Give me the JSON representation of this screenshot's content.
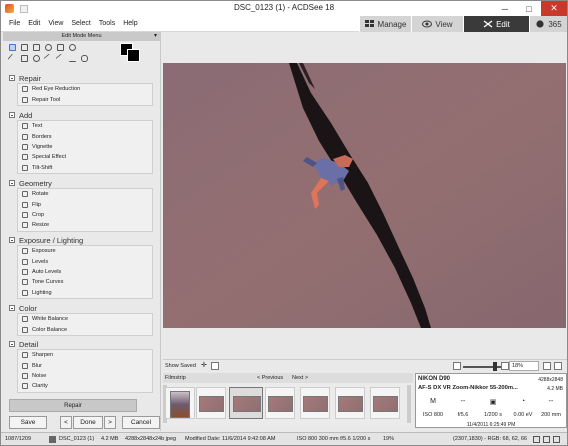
{
  "window": {
    "title": "DSC_0123 (1) - ACDSee 18",
    "min": "─",
    "max": "□",
    "close": "✕"
  },
  "menu": [
    "File",
    "Edit",
    "View",
    "Select",
    "Tools",
    "Help"
  ],
  "modes": {
    "manage": "Manage",
    "view": "View",
    "edit": "Edit",
    "s365": "365"
  },
  "left": {
    "panel_title": "Edit Mode Menu",
    "groups": [
      {
        "title": "Repair",
        "items": [
          "Red Eye Reduction",
          "Repair Tool"
        ]
      },
      {
        "title": "Add",
        "items": [
          "Text",
          "Borders",
          "Vignette",
          "Special Effect",
          "Tilt-Shift"
        ]
      },
      {
        "title": "Geometry",
        "items": [
          "Rotate",
          "Flip",
          "Crop",
          "Resize"
        ]
      },
      {
        "title": "Exposure / Lighting",
        "items": [
          "Exposure",
          "Levels",
          "Auto Levels",
          "Tone Curves",
          "Lighting"
        ]
      },
      {
        "title": "Color",
        "items": [
          "White Balance",
          "Color Balance"
        ]
      },
      {
        "title": "Detail",
        "items": [
          "Sharpen",
          "Blur",
          "Noise",
          "Clarity"
        ]
      }
    ],
    "repair_button": "Repair",
    "save": "Save",
    "done": "Done",
    "cancel": "Cancel",
    "prev": "<",
    "next": ">"
  },
  "viewbar": {
    "show_saved": "Show Saved",
    "zoom": "18%"
  },
  "filmstrip": {
    "label": "Filmstrip",
    "previous": "< Previous",
    "next": "Next >"
  },
  "info": {
    "camera": "NIKON D90",
    "lens": "AF-S DX VR Zoom-Nikkor 55-200m...",
    "dims": "4288x2848",
    "size": "4.2 MB",
    "mode": "M",
    "dash1": "--",
    "dash2": "--",
    "iso": "ISO 800",
    "aperture": "f/5.6",
    "shutter": "1/200 s",
    "ev": "0.00 eV",
    "focal": "200 mm",
    "date": "11/4/2011 6:25:49 PM"
  },
  "status": {
    "index": "1087/1209",
    "filename": "DSC_0123 (1)",
    "size": "4.2 MB",
    "dims": "4288x2848x24b jpeg",
    "modified": "Modified Date: 11/6/2014 9:42:08 AM",
    "exif": "ISO 800   300 mm   f/5.6   1/200 s",
    "zoom": "19%",
    "coords": "(2307,1830) - RGB: 68, 62, 66"
  }
}
